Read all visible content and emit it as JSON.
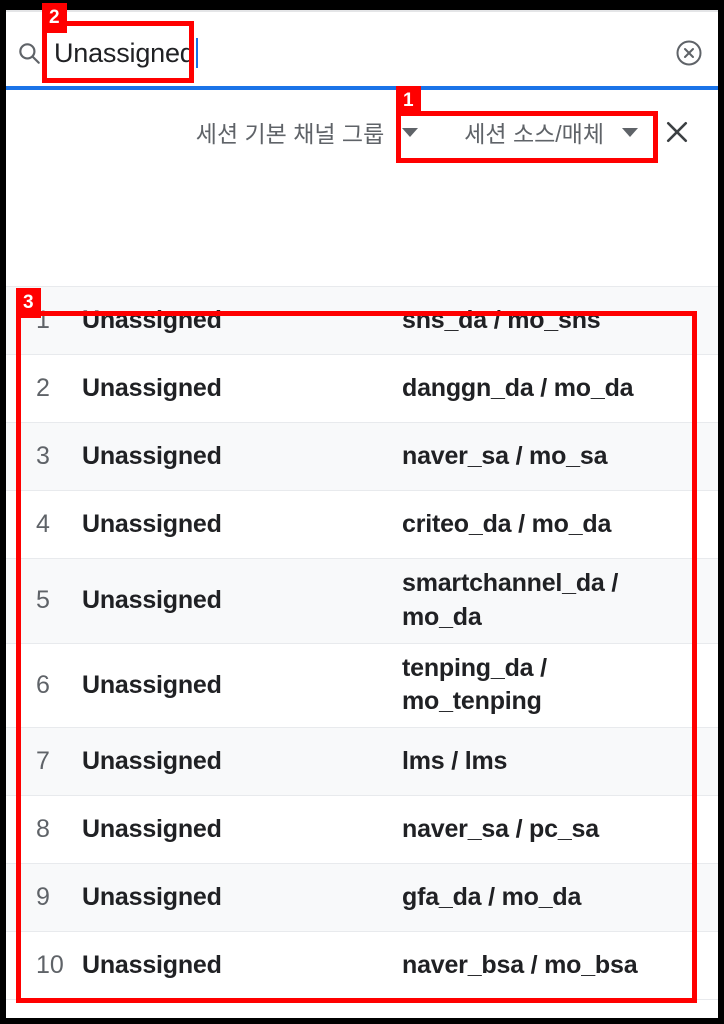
{
  "search": {
    "value": "Unassigned",
    "search_icon": "search-icon",
    "clear_icon": "clear-circle-x-icon"
  },
  "dimension_bar": {
    "secondary_label": "세션 기본 채널 그룹",
    "primary_label": "세션 소스/매체",
    "close_icon": "close-x-icon",
    "dropdown_icon": "chevron-down-icon"
  },
  "table": {
    "rows": [
      {
        "index": "1",
        "channel": "Unassigned",
        "source": "sns_da / mo_sns"
      },
      {
        "index": "2",
        "channel": "Unassigned",
        "source": "danggn_da / mo_da"
      },
      {
        "index": "3",
        "channel": "Unassigned",
        "source": "naver_sa / mo_sa"
      },
      {
        "index": "4",
        "channel": "Unassigned",
        "source": "criteo_da / mo_da"
      },
      {
        "index": "5",
        "channel": "Unassigned",
        "source": "smartchannel_da / mo_da"
      },
      {
        "index": "6",
        "channel": "Unassigned",
        "source": "tenping_da / mo_tenping"
      },
      {
        "index": "7",
        "channel": "Unassigned",
        "source": "lms / lms"
      },
      {
        "index": "8",
        "channel": "Unassigned",
        "source": "naver_sa / pc_sa"
      },
      {
        "index": "9",
        "channel": "Unassigned",
        "source": "gfa_da / mo_da"
      },
      {
        "index": "10",
        "channel": "Unassigned",
        "source": "naver_bsa / mo_bsa"
      }
    ]
  },
  "annotations": {
    "badge_1": "1",
    "badge_2": "2",
    "badge_3": "3",
    "color": "#ff0000"
  },
  "colors": {
    "accent": "#1a73e8",
    "text_primary": "#202124",
    "text_secondary": "#5f6368",
    "row_alt": "#f8f9fa",
    "divider": "#e8eaed"
  }
}
